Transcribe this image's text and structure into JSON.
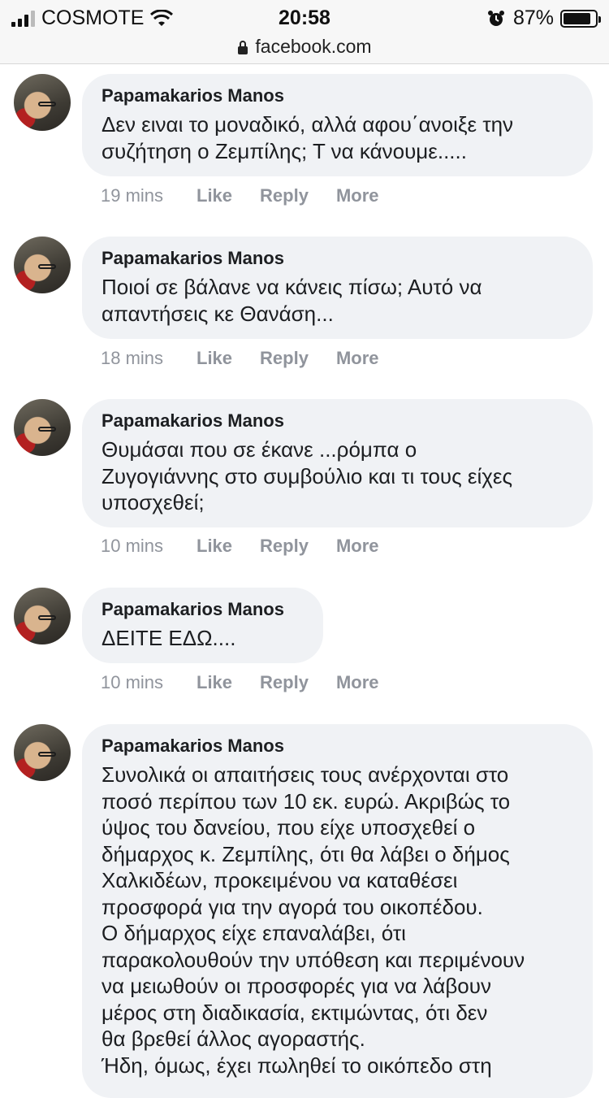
{
  "status": {
    "carrier": "COSMOTE",
    "time": "20:58",
    "battery": "87%",
    "battery_level": 0.87
  },
  "url": "facebook.com",
  "comments": [
    {
      "author": "Papamakarios Manos",
      "text": "Δεν ειναι το μοναδικό, αλλά αφου΄ανοιξε την\nσυζήτηση ο Ζεμπίλης; Τ να κάνουμε.....",
      "time": "19 mins",
      "like": "Like",
      "reply": "Reply",
      "more": "More"
    },
    {
      "author": "Papamakarios Manos",
      "text": "Ποιοί σε βάλανε να κάνεις πίσω; Αυτό να\nαπαντήσεις κε Θανάση...",
      "time": "18 mins",
      "like": "Like",
      "reply": "Reply",
      "more": "More"
    },
    {
      "author": "Papamakarios Manos",
      "text": "Θυμάσαι που σε έκανε ...ρόμπα ο\nΖυγογιάννης στο συμβούλιο και τι τους είχες\nυποσχεθεί;",
      "time": "10 mins",
      "like": "Like",
      "reply": "Reply",
      "more": "More"
    },
    {
      "author": "Papamakarios Manos",
      "text": "ΔΕΙΤΕ ΕΔΩ....",
      "time": "10 mins",
      "like": "Like",
      "reply": "Reply",
      "more": "More"
    },
    {
      "author": "Papamakarios Manos",
      "text": "Συνολικά οι απαιτήσεις τους ανέρχονται στο\nποσό περίπου των 10 εκ. ευρώ. Ακριβώς το\nύψος του δανείου, που είχε υποσχεθεί ο\nδήμαρχος κ. Ζεμπίλης, ότι θα λάβει ο δήμος\nΧαλκιδέων, προκειμένου να καταθέσει\nπροσφορά για την αγορά του οικοπέδου.\nΟ δήμαρχος είχε επαναλάβει, ότι\nπαρακολουθούν την υπόθεση και περιμένουν\nνα μειωθούν οι προσφορές για να λάβουν\nμέρος στη διαδικασία, εκτιμώντας, ότι δεν\nθα βρεθεί άλλος αγοραστής.\nΉδη, όμως, έχει πωληθεί το οικόπεδο στη"
    }
  ]
}
